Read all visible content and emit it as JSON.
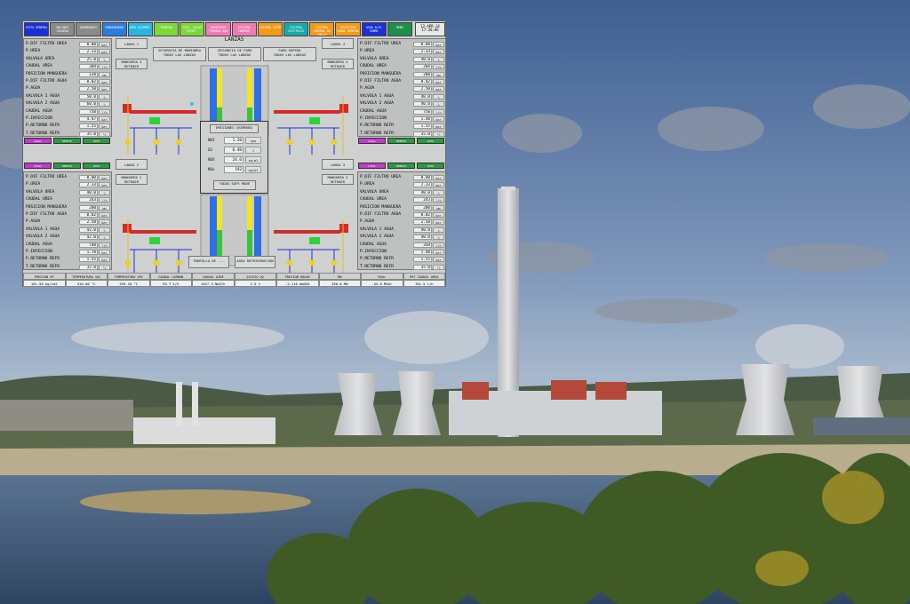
{
  "topbar": {
    "buttons": [
      {
        "label": "VISTA GENERAL",
        "color": "#1b2fd6"
      },
      {
        "label": "MOLINOS CALDERA",
        "color": "#8a8a8a"
      },
      {
        "label": "QUEMADORES",
        "color": "#8a8a8a"
      },
      {
        "label": "CONDENSADOR",
        "color": "#2c7be0"
      },
      {
        "label": "AGUA ALIMENT.",
        "color": "#28b6e0"
      },
      {
        "label": "TURBINA",
        "color": "#7ed63a"
      },
      {
        "label": "SIST. CALOR RECUP.",
        "color": "#7ed63a"
      },
      {
        "label": "GENERADOR TURBINA GAS",
        "color": "#f07ab4"
      },
      {
        "label": "SISTEMA CONTROL",
        "color": "#f07ab4"
      },
      {
        "label": "SISTEMA VAPOR",
        "color": "#f39a1a"
      },
      {
        "label": "SISTEMA ELÉCTRICO",
        "color": "#19a9a5"
      },
      {
        "label": "SISTEMA CONTROL DE FALLA",
        "color": "#f39a1a"
      },
      {
        "label": "SELECCIÓN CARGA TURBINA",
        "color": "#f39a1a"
      },
      {
        "label": "AGUA ALTA SOBRE",
        "color": "#1b2fd6"
      },
      {
        "label": "MENÚ",
        "color": "#1d8f4a"
      }
    ],
    "date": "12-APR-14",
    "time": "17:36:06"
  },
  "left_top": {
    "rows": [
      {
        "label": "P.DIF FILTRO UREA",
        "value": "0.00",
        "unit": "bar"
      },
      {
        "label": "P.UREA",
        "value": "2.33",
        "unit": "bar"
      },
      {
        "label": "VALVULA UREA",
        "value": "25.0",
        "unit": "%"
      },
      {
        "label": "CAUDAL UREA",
        "value": "204",
        "unit": "l/h"
      },
      {
        "label": "POSICION MANGUERA",
        "value": "120",
        "unit": "mm"
      },
      {
        "label": "P.DIF FILTRO AGUA",
        "value": "0.02",
        "unit": "bar"
      },
      {
        "label": "P.AGUA",
        "value": "2.50",
        "unit": "bar"
      },
      {
        "label": "VALVULA 1 AGUA",
        "value": "50.0",
        "unit": "%"
      },
      {
        "label": "VALVULA 2 AGUA",
        "value": "60.0",
        "unit": "%"
      },
      {
        "label": "CAUDAL AGUA",
        "value": "750",
        "unit": "l/h"
      },
      {
        "label": "P.INYECCION",
        "value": "4.47",
        "unit": "bar"
      },
      {
        "label": "P.RETORNO REFR",
        "value": "1.55",
        "unit": "bar"
      },
      {
        "label": "T.RETORNO REFR",
        "value": "35.0",
        "unit": "°C"
      }
    ]
  },
  "left_bottom": {
    "rows": [
      {
        "label": "P.DIF FILTRO UREA",
        "value": "0.00",
        "unit": "bar"
      },
      {
        "label": "P.UREA",
        "value": "2.33",
        "unit": "bar"
      },
      {
        "label": "VALVULA UREA",
        "value": "40.0",
        "unit": "%"
      },
      {
        "label": "CAUDAL UREA",
        "value": "243",
        "unit": "l/h"
      },
      {
        "label": "POSICION MANGUERA",
        "value": "200",
        "unit": "mm"
      },
      {
        "label": "P.DIF FILTRO AGUA",
        "value": "0.02",
        "unit": "bar"
      },
      {
        "label": "P.AGUA",
        "value": "2.50",
        "unit": "bar"
      },
      {
        "label": "VALVULA 1 AGUA",
        "value": "42.0",
        "unit": "%"
      },
      {
        "label": "VALVULA 2 AGUA",
        "value": "42.0",
        "unit": "%"
      },
      {
        "label": "CAUDAL AGUA",
        "value": "740",
        "unit": "l/h"
      },
      {
        "label": "P.INYECCION",
        "value": "1.78",
        "unit": "bar"
      },
      {
        "label": "P.RETORNO REFR",
        "value": "1.55",
        "unit": "bar"
      },
      {
        "label": "T.RETORNO REFR",
        "value": "32.0",
        "unit": "°C"
      }
    ]
  },
  "right_top": {
    "rows": [
      {
        "label": "P.DIF FILTRO UREA",
        "value": "0.00",
        "unit": "bar"
      },
      {
        "label": "P.UREA",
        "value": "2.33",
        "unit": "bar"
      },
      {
        "label": "VALVULA UREA",
        "value": "40.0",
        "unit": "%"
      },
      {
        "label": "CAUDAL UREA",
        "value": "204",
        "unit": "l/h"
      },
      {
        "label": "POSICION MANGUERA",
        "value": "200",
        "unit": "mm"
      },
      {
        "label": "P.DIF FILTRO AGUA",
        "value": "0.02",
        "unit": "bar"
      },
      {
        "label": "P.AGUA",
        "value": "2.50",
        "unit": "bar"
      },
      {
        "label": "VALVULA 1 AGUA",
        "value": "40.0",
        "unit": "%"
      },
      {
        "label": "VALVULA 2 AGUA",
        "value": "40.0",
        "unit": "%"
      },
      {
        "label": "CAUDAL AGUA",
        "value": "750",
        "unit": "l/h"
      },
      {
        "label": "P.INYECCION",
        "value": "1.48",
        "unit": "bar"
      },
      {
        "label": "P.RETORNO REFR",
        "value": "1.55",
        "unit": "bar"
      },
      {
        "label": "T.RETORNO REFR",
        "value": "35.0",
        "unit": "°C"
      }
    ]
  },
  "right_bottom": {
    "rows": [
      {
        "label": "P.DIF FILTRO UREA",
        "value": "0.00",
        "unit": "bar"
      },
      {
        "label": "P.UREA",
        "value": "2.33",
        "unit": "bar"
      },
      {
        "label": "VALVULA UREA",
        "value": "40.0",
        "unit": "%"
      },
      {
        "label": "CAUDAL UREA",
        "value": "243",
        "unit": "l/h"
      },
      {
        "label": "POSICION MANGUERA",
        "value": "200",
        "unit": "mm"
      },
      {
        "label": "P.DIF FILTRO AGUA",
        "value": "0.02",
        "unit": "bar"
      },
      {
        "label": "P.AGUA",
        "value": "2.50",
        "unit": "bar"
      },
      {
        "label": "VALVULA 1 AGUA",
        "value": "40.0",
        "unit": "%"
      },
      {
        "label": "VALVULA 2 AGUA",
        "value": "40.0",
        "unit": "%"
      },
      {
        "label": "CAUDAL AGUA",
        "value": "350",
        "unit": "l/h"
      },
      {
        "label": "P.INYECCION",
        "value": "1.48",
        "unit": "bar"
      },
      {
        "label": "P.RETORNO REFR",
        "value": "1.55",
        "unit": "bar"
      },
      {
        "label": "T.RETORNO REFR",
        "value": "35.0",
        "unit": "°C"
      }
    ]
  },
  "chips_row": [
    {
      "label": "LOCAL",
      "color": "#c23ac9"
    },
    {
      "label": "REMOTO",
      "color": "#2a9a45"
    },
    {
      "label": "AUTO",
      "color": "#2a9a45"
    }
  ],
  "center": {
    "title": "LANZAS",
    "lanza_top_left": "LANZA 1",
    "lanza_top_right": "LANZA 4",
    "lanza_bottom_left": "LANZA 2",
    "lanza_bottom_right": "LANZA 3",
    "seq_left": "SECUENCIA DE MANIOBRA",
    "seq_left_sub": "TODAS LAS LANZAS",
    "seq_mid": "SECUENCIA DE PARO",
    "seq_mid_sub": "TODAS LAS LANZAS",
    "seq_right": "PARO RAPIDO",
    "seq_right_sub": "TODAS LAS LANZAS",
    "manguera_tl": "MANGUERA 4 RETRAER",
    "manguera_tr": "MANGUERA 4 RETRAER",
    "manguera_bl": "MANGUERA 2 RETRAER",
    "manguera_br": "MANGUERA 2 RETRAER",
    "emis_title": "EMISIONES CHIMENEA",
    "emis_rows": [
      {
        "label": "NH3",
        "value": "1.20",
        "unit": "ppm"
      },
      {
        "label": "O2",
        "value": "6.40",
        "unit": "%"
      },
      {
        "label": "NOX",
        "value": "24.6",
        "unit": "mg/m3"
      },
      {
        "label": "NOx",
        "value": "192",
        "unit": "mg/m3"
      }
    ],
    "emis_btn": "TODAS SAFE MODE",
    "pantalla": "PANTALLA DE ...",
    "agua": "AGUA REFRIGERACION"
  },
  "bottom_bar": [
    {
      "label": "PRESION VP",
      "value": "101.50 kg/cm2"
    },
    {
      "label": "TEMPERATURA VAC",
      "value": "510.00 °C"
    },
    {
      "label": "TEMPERATURA VRC",
      "value": "539.10 °C"
    },
    {
      "label": "CAUDAL CARBON",
      "value": "93.7 t/h"
    },
    {
      "label": "CAUDAL AIRE",
      "value": "1027.3 Nm3/h"
    },
    {
      "label": "EXCESO O2",
      "value": "2.5 %"
    },
    {
      "label": "PRESION HOGAR",
      "value": "-2.116 mmH2O"
    },
    {
      "label": "MW",
      "value": "350.0 MW"
    },
    {
      "label": "MVAr",
      "value": "-55.0 MVAr"
    },
    {
      "label": "PRT CAUDAL UREA",
      "value": "761.5 l/h"
    }
  ]
}
